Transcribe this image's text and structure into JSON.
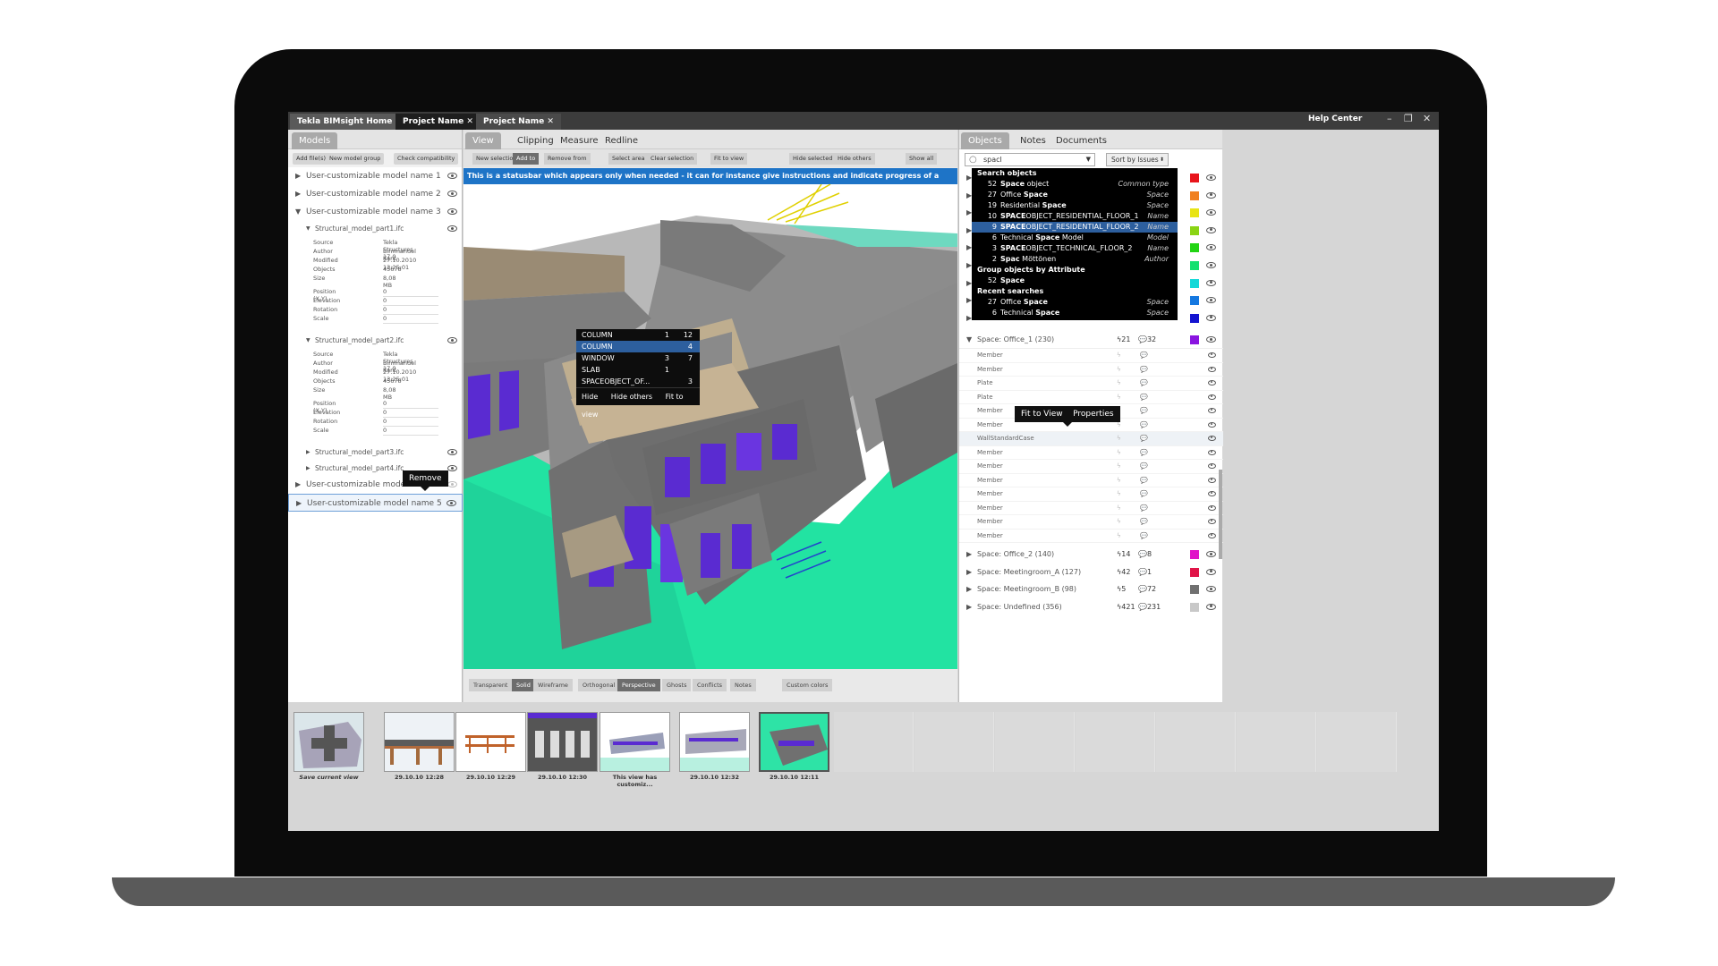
{
  "titlebar": {
    "tabs": [
      "Tekla BIMsight Home",
      "Project Name ✕",
      "Project Name ✕"
    ],
    "help": "Help Center",
    "controls": [
      "–",
      "❐",
      "✕"
    ]
  },
  "models_panel": {
    "tab": "Models",
    "buttons": [
      "Add file(s)",
      "New model group",
      "Check compatibility"
    ],
    "groups": [
      "User-customizable model name 1",
      "User-customizable model name 2",
      "User-customizable model name 3"
    ],
    "part1": {
      "name": "Structural_model_part1.ifc",
      "props": [
        [
          "Source",
          "Tekla Structures 17.0"
        ],
        [
          "Author",
          "Bimmanuel Kant"
        ],
        [
          "Modified",
          "27.10.2010 13:25:01"
        ],
        [
          "Objects",
          "45678"
        ],
        [
          "Size",
          "8,08 MB"
        ]
      ],
      "pos": [
        [
          "Position (X,Y)",
          "0"
        ],
        [
          "Elevation",
          "0"
        ],
        [
          "Rotation",
          "0"
        ],
        [
          "Scale",
          "0"
        ]
      ]
    },
    "part2": {
      "name": "Structural_model_part2.ifc",
      "props": [
        [
          "Source",
          "Tekla Structures 17.0"
        ],
        [
          "Author",
          "Bimmanuel Kant"
        ],
        [
          "Modified",
          "27.10.2010 13:25:01"
        ],
        [
          "Objects",
          "45678"
        ],
        [
          "Size",
          "8,08 MB"
        ]
      ],
      "pos": [
        [
          "Position (X,Y)",
          "0"
        ],
        [
          "Elevation",
          "0"
        ],
        [
          "Rotation",
          "0"
        ],
        [
          "Scale",
          "0"
        ]
      ]
    },
    "part3": "Structural_model_part3.ifc",
    "part4": "Structural_model_part4.ifc",
    "model4": "User-customizable model name 4",
    "model5": "User-customizable model name 5",
    "remove_tooltip": "Remove"
  },
  "view_panel": {
    "tabs": [
      "View",
      "Clipping",
      "Measure",
      "Redline"
    ],
    "tools": [
      "New selection",
      "Add to",
      "Remove from",
      "Select area",
      "Clear selection",
      "Fit to view",
      "Hide selected",
      "Hide others",
      "Show all"
    ],
    "status": "This is a statusbar which appears only when needed - it can for instance give instructions and indicate progress of a process",
    "context_menu": {
      "rows": [
        {
          "label": "COLUMN",
          "issues": "1",
          "comments": "12"
        },
        {
          "label": "COLUMN",
          "issues": "",
          "comments": "4"
        },
        {
          "label": "WINDOW",
          "issues": "3",
          "comments": "7"
        },
        {
          "label": "SLAB",
          "issues": "1",
          "comments": ""
        },
        {
          "label": "SPACEOBJECT_OF...",
          "issues": "",
          "comments": "3"
        }
      ],
      "actions": [
        "Hide",
        "Hide others",
        "Fit to view"
      ]
    },
    "bottom": [
      "Transparent",
      "Solid",
      "Wireframe",
      "Orthogonal",
      "Perspective",
      "Ghosts",
      "Conflicts",
      "Notes",
      "Custom colors"
    ]
  },
  "objects_panel": {
    "tabs": [
      "Objects",
      "Notes",
      "Documents"
    ],
    "search_value": "spacl",
    "sort": "Sort by Issues",
    "dropdown": {
      "h1": "Search objects",
      "items": [
        {
          "n": "52",
          "b": "Space",
          "r": " object",
          "type": "Common type"
        },
        {
          "n": "27",
          "b": "",
          "r": "Office ",
          "b2": "Space",
          "type": "Space"
        },
        {
          "n": "19",
          "b": "",
          "r": "Residential ",
          "b2": "Space",
          "type": "Space"
        },
        {
          "n": "10",
          "b": "SPACE",
          "r": "OBJECT_RESIDENTIAL_FLOOR_1",
          "type": "Name"
        },
        {
          "n": "9",
          "b": "SPACE",
          "r": "OBJECT_RESIDENTIAL_FLOOR_2",
          "type": "Name"
        },
        {
          "n": "6",
          "b": "",
          "r": "Technical ",
          "b2": "Space",
          "r2": " Model",
          "type": "Model"
        },
        {
          "n": "3",
          "b": "SPACE",
          "r": "OBJECT_TECHNICAL_FLOOR_2",
          "type": "Name"
        },
        {
          "n": "2",
          "b": "Spac",
          "r": " Möttönen",
          "type": "Author"
        }
      ],
      "h2": "Group objects by Attribute",
      "group_item": {
        "n": "52",
        "b": "Space",
        "r": ""
      },
      "h3": "Recent searches",
      "recent": [
        {
          "n": "27",
          "b": "",
          "r": "Office ",
          "b2": "Space",
          "type": "Space"
        },
        {
          "n": "6",
          "b": "",
          "r": "Technical ",
          "b2": "Space",
          "type": "Space"
        }
      ]
    },
    "swatches": [
      "#e8141b",
      "#f08020",
      "#e8e414",
      "#8ad414",
      "#22d414",
      "#14e070",
      "#14d8d8",
      "#1478e0",
      "#1414d0"
    ],
    "office1": {
      "label": "Space: Office_1 (230)",
      "issues": "21",
      "comments": "32",
      "color": "#8a14e0"
    },
    "members": [
      "Member",
      "Member",
      "Plate",
      "Plate",
      "Member",
      "Member",
      "WallStandardCase",
      "Member",
      "Member",
      "Member",
      "Member",
      "Member",
      "Member",
      "Member"
    ],
    "member_tooltip": [
      "Fit to View",
      "Properties"
    ],
    "spaces": [
      {
        "label": "Space: Office_2 (140)",
        "issues": "14",
        "comments": "8",
        "color": "#e014c8"
      },
      {
        "label": "Space: Meetingroom_A (127)",
        "issues": "42",
        "comments": "1",
        "color": "#e01448"
      },
      {
        "label": "Space: Meetingroom_B (98)",
        "issues": "5",
        "comments": "72",
        "color": "#707070"
      },
      {
        "label": "Space: Undefined (356)",
        "issues": "421",
        "comments": "231",
        "color": "#c8c8c8"
      }
    ]
  },
  "filmstrip": {
    "captions": [
      "Save current view",
      "29.10.10 12:28",
      "29.10.10 12:29",
      "29.10.10 12:30",
      "This view has customiz...",
      "29.10.10 12:32",
      "29.10.10 12:11"
    ]
  }
}
